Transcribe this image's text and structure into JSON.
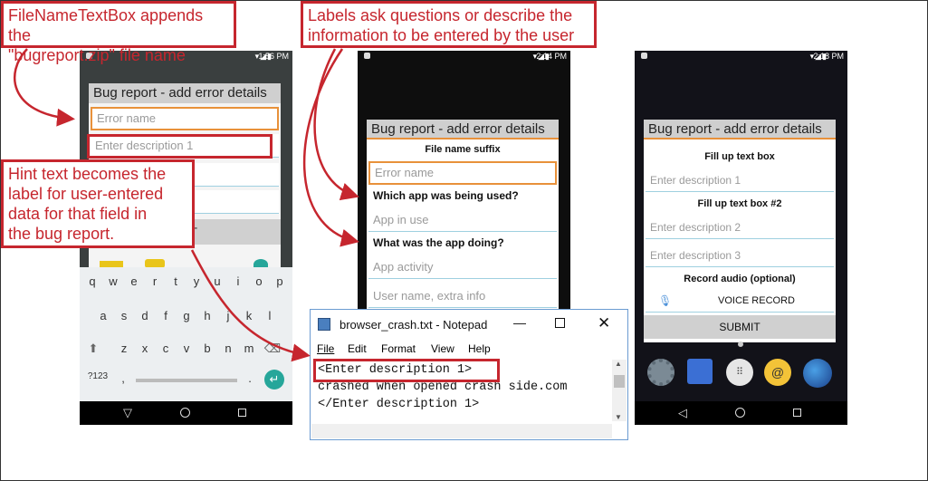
{
  "callouts": {
    "filename": "FileNameTextBox appends the \"bugreport.zip\" file name",
    "filename_l1": "FileNameTextBox appends the",
    "filename_l2": "\"bugreport.zip\" file name",
    "labels_l1": "Labels ask questions or describe the",
    "labels_l2": "information to be entered by the user",
    "hint_l1": "Hint text becomes the",
    "hint_l2": "label for user-entered",
    "hint_l3": "data for that field in",
    "hint_l4": "the bug report."
  },
  "phone1": {
    "time": "1:56 PM",
    "title": "Bug report - add error details",
    "field1_hint": "Error name",
    "field2_hint": "Enter description 1",
    "submit_partial": "IT",
    "keyboard": {
      "row1": [
        "q",
        "w",
        "e",
        "r",
        "t",
        "y",
        "u",
        "i",
        "o",
        "p"
      ],
      "row2": [
        "a",
        "s",
        "d",
        "f",
        "g",
        "h",
        "j",
        "k",
        "l"
      ],
      "row3": [
        "z",
        "x",
        "c",
        "v",
        "b",
        "n",
        "m"
      ],
      "sym": "?123",
      "comma": ",",
      "period": "."
    }
  },
  "phone2": {
    "time": "2:14 PM",
    "title": "Bug report - add error details",
    "label_suffix": "File name suffix",
    "field_error": "Error name",
    "label_which_app": "Which app was being used?",
    "field_app": "App in use",
    "label_what_doing": "What was the app doing?",
    "field_activity": "App activity",
    "field_user": "User name, extra info"
  },
  "phone3": {
    "time": "2:18 PM",
    "title": "Bug report - add error details",
    "label_fill1": "Fill up text box",
    "field_desc1": "Enter description 1",
    "label_fill2": "Fill up text box #2",
    "field_desc2": "Enter description 2",
    "field_desc3": "Enter description 3",
    "label_audio": "Record audio (optional)",
    "voice_record": "VOICE RECORD",
    "submit": "SUBMIT"
  },
  "notepad": {
    "title": "browser_crash.txt - Notepad",
    "menu": [
      "File",
      "Edit",
      "Format",
      "View",
      "Help"
    ],
    "line1": "<Enter description 1>",
    "line2": "crashed when opened crash side.com",
    "line3": "</Enter description 1>"
  },
  "colors": {
    "callout_red": "#c6262e",
    "focus_orange": "#e8913a",
    "field_underline": "#9fd0e0",
    "accent_teal": "#26a69a"
  }
}
